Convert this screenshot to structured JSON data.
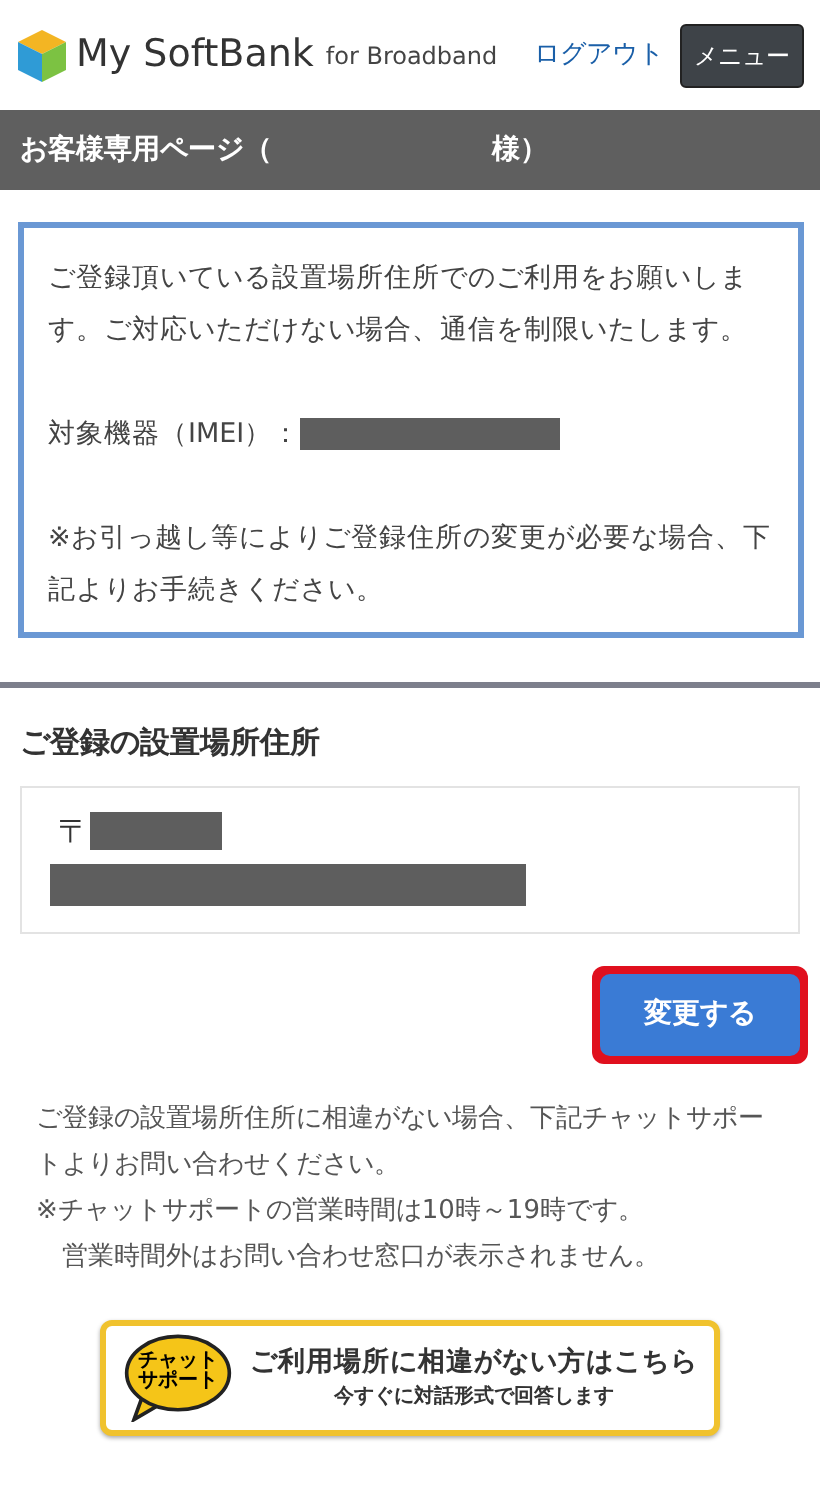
{
  "header": {
    "brand": "My SoftBank",
    "brand_sub": "for Broadband",
    "logout": "ログアウト",
    "menu": "メニュー"
  },
  "title_bar": {
    "left": "お客様専用ページ（",
    "right": "様）"
  },
  "notice": {
    "paragraphs": [
      "ご登録頂いている設置場所住所でのご利用をお願いします。ご対応いただけない場合、通信を制限いたします。",
      "※お引っ越し等によりご登録住所の変更が必要な場合、下記よりお手続きください。"
    ],
    "imei_label": "対象機器（IMEI）："
  },
  "address": {
    "heading": "ご登録の設置場所住所",
    "postal_mark": "〒"
  },
  "change_button": {
    "label": "変更する",
    "highlighted": true
  },
  "info": [
    "ご登録の設置場所住所に相違がない場合、下記チャットサポートよりお問い合わせください。",
    "※チャットサポートの営業時間は10時～19時です。",
    "営業時間外はお問い合わせ窓口が表示されません。"
  ],
  "chat_button": {
    "badge": [
      "チャット",
      "サポート"
    ],
    "title": "ご利用場所に相違がない方はこちら",
    "subtitle": "今すぐに対話形式で回答します"
  }
}
